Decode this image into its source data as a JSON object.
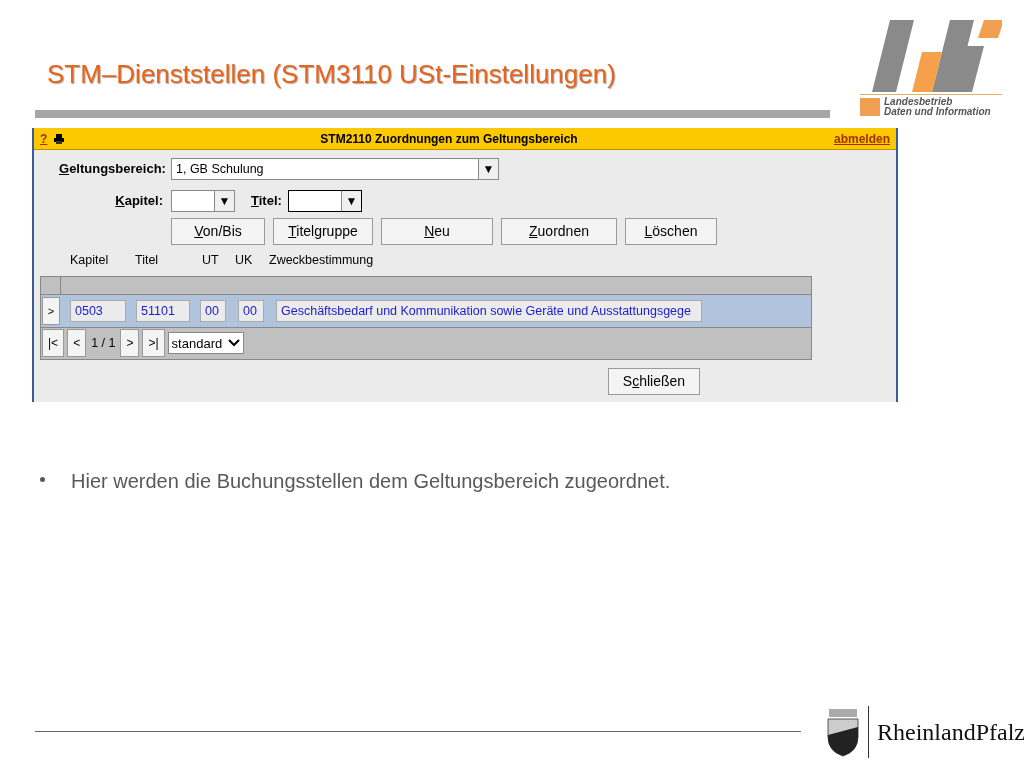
{
  "slide_title": "STM–Dienststellen (STM3110 USt-Einstellungen)",
  "logo": {
    "line_1": "Landesbetrieb",
    "line_2": "Daten und Information"
  },
  "window": {
    "help": "?",
    "title": "STM2110 Zuordnungen zum Geltungsbereich",
    "logout": "abmelden",
    "geltungsbereich": {
      "label": {
        "key": "G",
        "post": "eltungsbereich:"
      },
      "value": "1, GB Schulung",
      "arrow": "▼"
    },
    "kapitel": {
      "label": {
        "key": "K",
        "post": "apitel:"
      },
      "arrow": "▼"
    },
    "titel": {
      "label": {
        "key": "T",
        "post": "itel:"
      },
      "arrow": "▼"
    },
    "buttons": [
      {
        "key": "V",
        "post": "on/Bis"
      },
      {
        "key": "T",
        "post": "itelgruppe"
      },
      {
        "key": "N",
        "post": "eu"
      },
      {
        "key": "Z",
        "post": "uordnen"
      },
      {
        "key": "L",
        "post": "öschen"
      }
    ],
    "columns": [
      "Kapitel",
      "Titel",
      "UT",
      "UK",
      "Zweckbestimmung"
    ],
    "rows": [
      {
        "marker": ">",
        "selected": true,
        "cells": [
          "0503",
          "51101",
          "00",
          "00",
          "Geschäftsbedarf und Kommunikation sowie Geräte und Ausstattungsgege"
        ]
      }
    ],
    "pager": {
      "first": "|<",
      "prev": "<",
      "page": "1 / 1",
      "next": ">",
      "last": ">|",
      "view": "standard"
    },
    "close_button": {
      "pre": "S",
      "key": "c",
      "post": "hließen"
    }
  },
  "bullets": [
    "Hier werden die Buchungsstellen dem Geltungsbereich zugeordnet."
  ],
  "footer": {
    "state": "RheinlandPfalz"
  }
}
